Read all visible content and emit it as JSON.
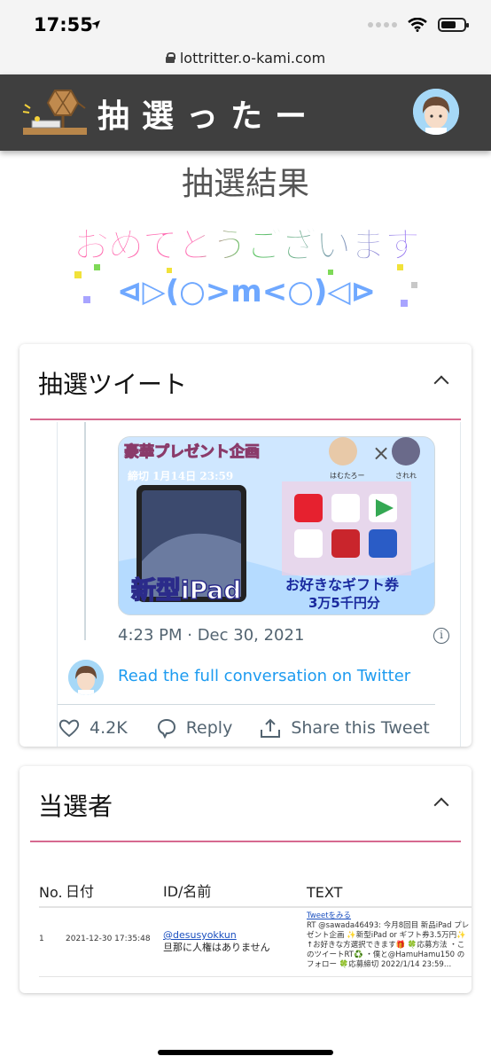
{
  "status_bar": {
    "time": "17:55"
  },
  "browser": {
    "url": "lottritter.o-kami.com"
  },
  "header": {
    "site_title": "抽選ったー"
  },
  "page": {
    "title": "抽選結果",
    "congrats_line1": "おめでとうございます",
    "congrats_line2": "⊲▷(○>m<○)◁⊳"
  },
  "tweet_card": {
    "title": "抽選ツイート",
    "image": {
      "banner": "豪華プレゼント企画",
      "deadline": "締切 1月14日 23:59",
      "name_left": "はむたろー",
      "name_right": "されれ",
      "product": "新型iPad",
      "gift_line1": "お好きなギフト券",
      "gift_line2": "3万5千円分"
    },
    "timestamp": "4:23 PM · Dec 30, 2021",
    "read_full": "Read the full conversation on Twitter",
    "likes": "4.2K",
    "reply_label": "Reply",
    "share_label": "Share this Tweet"
  },
  "winners_card": {
    "title": "当選者",
    "headers": {
      "no": "No.",
      "date": "日付",
      "id": "ID/名前",
      "text": "TEXT"
    },
    "rows": [
      {
        "no": "1",
        "date": "2021-12-30 17:35:48",
        "user_id": "@desusyokkun",
        "user_name": "旦那に人権はありません",
        "tweet_link": "Tweetをみる",
        "text": "RT @sawada46493: 今月8回目 新品iPad プレゼント企画 ✨新型iPad or ギフト券3.5万円✨ ↑お好きな方選択できます🎁 🍀応募方法 ・このツイートRT♻️ ・僕と@HamuHamu150 のフォロー 🍀応募締切 2022/1/14 23:59…"
      }
    ]
  },
  "colors": {
    "header_bg": "#3f3f3f",
    "accent_line": "#d6698f",
    "link_blue": "#1d9bf0"
  }
}
